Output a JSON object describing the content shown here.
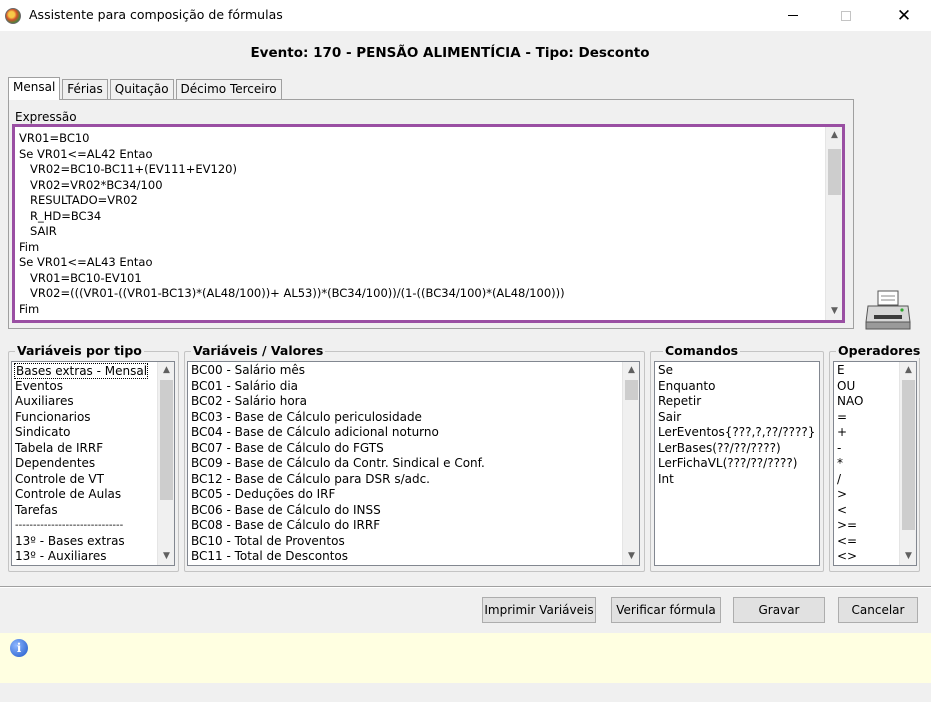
{
  "window": {
    "title": "Assistente para composição de fórmulas",
    "close_glyph": "✕"
  },
  "event_title": "Evento: 170 - PENSÃO ALIMENTÍCIA - Tipo: Desconto",
  "tabs": [
    {
      "label": "Mensal",
      "active": true
    },
    {
      "label": "Férias",
      "active": false
    },
    {
      "label": "Quitação",
      "active": false
    },
    {
      "label": "Décimo Terceiro",
      "active": false
    }
  ],
  "expression": {
    "label": "Expressão",
    "lines": [
      "VR01=BC10",
      "Se VR01<=AL42 Entao",
      "   VR02=BC10-BC11+(EV111+EV120)",
      "   VR02=VR02*BC34/100",
      "   RESULTADO=VR02",
      "   R_HD=BC34",
      "   SAIR",
      "Fim",
      "Se VR01<=AL43 Entao",
      "   VR01=BC10-EV101",
      "   VR02=(((VR01-((VR01-BC13)*(AL48/100))+ AL53))*(BC34/100))/(1-((BC34/100)*(AL48/100)))",
      "Fim"
    ]
  },
  "variaveis_por_tipo": {
    "label": "Variáveis por tipo",
    "items": [
      "Bases extras - Mensal",
      "Eventos",
      "Auxiliares",
      "Funcionarios",
      "Sindicato",
      "Tabela de IRRF",
      "Dependentes",
      "Controle de VT",
      "Controle de Aulas",
      "Tarefas",
      "------------------------------",
      "13º - Bases extras",
      "13º - Auxiliares"
    ]
  },
  "variaveis_valores": {
    "label": "Variáveis / Valores",
    "items": [
      "BC00 - Salário mês",
      "BC01 - Salário dia",
      "BC02 - Salário hora",
      "BC03 - Base de Cálculo periculosidade",
      "BC04 - Base de Cálculo adicional noturno",
      "BC07 - Base de Cálculo do FGTS",
      "BC09 - Base de Cálculo da Contr. Sindical e Conf.",
      "BC12 - Base de Cálculo para DSR s/adc.",
      "BC05 - Deduções do IRF",
      "BC06 - Base de Cálculo do INSS",
      "BC08 - Base de Cálculo do IRRF",
      "BC10 - Total de Proventos",
      "BC11 - Total de Descontos"
    ]
  },
  "comandos": {
    "label": "Comandos",
    "items": [
      "Se",
      "Enquanto",
      "Repetir",
      "Sair",
      "LerEventos{???,?,??/????}",
      "LerBases(??/??/????)",
      "LerFichaVL(???/??/????)",
      "Int"
    ]
  },
  "operadores": {
    "label": "Operadores",
    "items": [
      "E",
      "OU",
      "NAO",
      "=",
      "+",
      "-",
      "*",
      "/",
      ">",
      "<",
      ">=",
      "<=",
      "<>"
    ]
  },
  "buttons": {
    "imprimir": "Imprimir Variáveis",
    "verificar": "Verificar fórmula",
    "gravar": "Gravar",
    "cancelar": "Cancelar"
  },
  "info": {
    "icon_glyph": "i"
  },
  "colors": {
    "expression_border": "#9a4fa3",
    "info_bar": "#ffffe1"
  }
}
